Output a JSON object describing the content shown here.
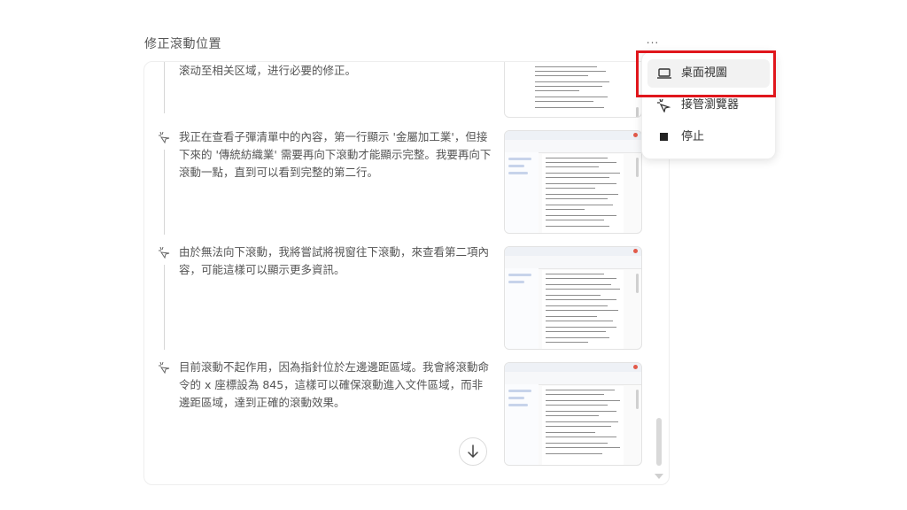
{
  "header": {
    "title": "修正滾動位置",
    "more_label": "..."
  },
  "steps": [
    {
      "text": "滚动至相关区域，进行必要的修正。"
    },
    {
      "text": "我正在查看子彈清單中的內容，第一行顯示 '金屬加工業'，但接下來的 '傳統紡織業' 需要再向下滾動才能顯示完整。我要再向下滾動一點，直到可以看到完整的第二行。"
    },
    {
      "text": "由於無法向下滾動，我將嘗試將視窗往下滾動，來查看第二項內容，可能這樣可以顯示更多資訊。"
    },
    {
      "text": "目前滾動不起作用，因為指針位於左邊邊距區域。我會將滾動命令的 x 座標設為 845，這樣可以確保滾動進入文件區域，而非邊距區域，達到正確的滾動效果。"
    }
  ],
  "menu": {
    "items": [
      {
        "label": "桌面視圖",
        "icon": "laptop-icon",
        "selected": true
      },
      {
        "label": "接管瀏覽器",
        "icon": "cursor-click-icon",
        "selected": false
      },
      {
        "label": "停止",
        "icon": "stop-icon",
        "selected": false
      }
    ]
  },
  "colors": {
    "highlight": "#e0161c",
    "text": "#555555",
    "timeline": "#d6d6d6"
  }
}
